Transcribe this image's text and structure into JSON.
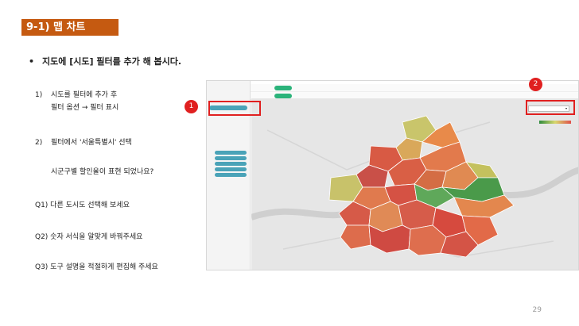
{
  "slide": {
    "title": "9-1) 맵 차트",
    "bullet": "지도에 [시도] 필터를 추가 해 봅시다.",
    "steps": [
      {
        "num": "1)",
        "lines": [
          "시도를 필터에 추가 후",
          "필터 옵션 → 필터 표시"
        ]
      },
      {
        "num": "2)",
        "lines": [
          "필터에서 '서울특별시' 선택"
        ]
      }
    ],
    "question_intro": "시군구별 할인율이 표현 되었나요?",
    "questions": [
      "Q1) 다른 도시도 선택해 보세요",
      "Q2) 숫자 서식을 알맞게 바꿔주세요",
      "Q3) 도구 설명을 적절하게 편집해 주세요"
    ],
    "page_number": "29"
  },
  "callouts": [
    "1",
    "2"
  ],
  "colors": {
    "title_bg": "#c55a11",
    "callout": "#e02020",
    "pill": "#2bb37a"
  }
}
